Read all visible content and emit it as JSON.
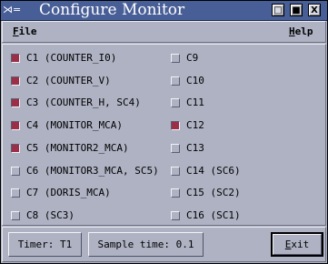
{
  "window": {
    "title": "Configure Monitor",
    "sys_menu": "⋊=",
    "buttons": [
      "□",
      "■",
      "X"
    ]
  },
  "menubar": {
    "file": "File",
    "help": "Help"
  },
  "channels_left": [
    {
      "label": "C1 (COUNTER_I0)",
      "checked": true
    },
    {
      "label": "C2 (COUNTER_V)",
      "checked": true
    },
    {
      "label": "C3 (COUNTER_H, SC4)",
      "checked": true
    },
    {
      "label": "C4 (MONITOR_MCA)",
      "checked": true
    },
    {
      "label": "C5 (MONITOR2_MCA)",
      "checked": true
    },
    {
      "label": "C6 (MONITOR3_MCA, SC5)",
      "checked": false
    },
    {
      "label": "C7 (DORIS_MCA)",
      "checked": false
    },
    {
      "label": "C8 (SC3)",
      "checked": false
    }
  ],
  "channels_right": [
    {
      "label": "C9",
      "checked": false
    },
    {
      "label": "C10",
      "checked": false
    },
    {
      "label": "C11",
      "checked": false
    },
    {
      "label": "C12",
      "checked": true
    },
    {
      "label": "C13",
      "checked": false
    },
    {
      "label": "C14 (SC6)",
      "checked": false
    },
    {
      "label": "C15 (SC2)",
      "checked": false
    },
    {
      "label": "C16 (SC1)",
      "checked": false
    }
  ],
  "bottom": {
    "timer_label": "Timer: T1",
    "sample_time_label": "Sample time: 0.1",
    "exit_label": "Exit"
  },
  "colors": {
    "background": "#aeb2c3",
    "titlebar": "#485e97",
    "checked": "#9b2f47"
  }
}
